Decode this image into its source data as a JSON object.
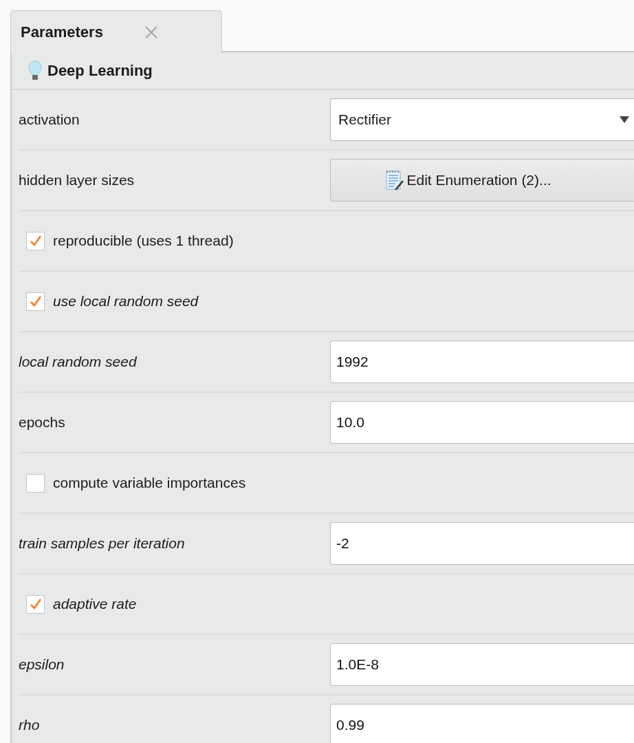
{
  "tab": {
    "label": "Parameters",
    "selected": true
  },
  "operator": {
    "name": "Deep Learning"
  },
  "parameters": [
    {
      "kind": "select",
      "label": "activation",
      "expert": false,
      "value": "Rectifier"
    },
    {
      "kind": "button",
      "label": "hidden layer sizes",
      "expert": false,
      "value": "Edit Enumeration (2)..."
    },
    {
      "kind": "checkbox",
      "label": "reproducible (uses 1 thread)",
      "expert": false,
      "checked": true
    },
    {
      "kind": "checkbox",
      "label": "use local random seed",
      "expert": true,
      "checked": true
    },
    {
      "kind": "text",
      "label": "local random seed",
      "expert": true,
      "value": "1992"
    },
    {
      "kind": "text",
      "label": "epochs",
      "expert": false,
      "value": "10.0"
    },
    {
      "kind": "checkbox",
      "label": "compute variable importances",
      "expert": false,
      "checked": false
    },
    {
      "kind": "text",
      "label": "train samples per iteration",
      "expert": true,
      "value": "-2"
    },
    {
      "kind": "checkbox",
      "label": "adaptive rate",
      "expert": true,
      "checked": true
    },
    {
      "kind": "text",
      "label": "epsilon",
      "expert": true,
      "value": "1.0E-8"
    },
    {
      "kind": "text",
      "label": "rho",
      "expert": true,
      "value": "0.99"
    }
  ]
}
